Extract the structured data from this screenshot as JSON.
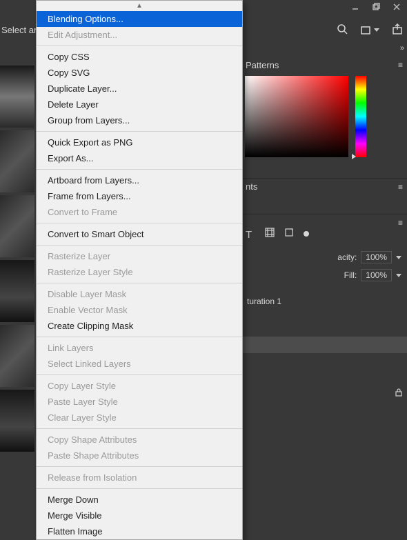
{
  "window": {
    "select_tool_text": "Select and"
  },
  "panels": {
    "tab_patterns": "Patterns",
    "tab_properties_fragment": "nts",
    "opacity_label": "acity:",
    "opacity_value": "100%",
    "fill_label": "Fill:",
    "fill_value": "100%",
    "adjustment_layer": "turation 1"
  },
  "menu": {
    "items": [
      {
        "label": "Blending Options...",
        "disabled": false,
        "highlight": true
      },
      {
        "label": "Edit Adjustment...",
        "disabled": true
      },
      {
        "sep": true
      },
      {
        "label": "Copy CSS"
      },
      {
        "label": "Copy SVG"
      },
      {
        "label": "Duplicate Layer..."
      },
      {
        "label": "Delete Layer"
      },
      {
        "label": "Group from Layers..."
      },
      {
        "sep": true
      },
      {
        "label": "Quick Export as PNG"
      },
      {
        "label": "Export As..."
      },
      {
        "sep": true
      },
      {
        "label": "Artboard from Layers..."
      },
      {
        "label": "Frame from Layers..."
      },
      {
        "label": "Convert to Frame",
        "disabled": true
      },
      {
        "sep": true
      },
      {
        "label": "Convert to Smart Object"
      },
      {
        "sep": true
      },
      {
        "label": "Rasterize Layer",
        "disabled": true
      },
      {
        "label": "Rasterize Layer Style",
        "disabled": true
      },
      {
        "sep": true
      },
      {
        "label": "Disable Layer Mask",
        "disabled": true
      },
      {
        "label": "Enable Vector Mask",
        "disabled": true
      },
      {
        "label": "Create Clipping Mask"
      },
      {
        "sep": true
      },
      {
        "label": "Link Layers",
        "disabled": true
      },
      {
        "label": "Select Linked Layers",
        "disabled": true
      },
      {
        "sep": true
      },
      {
        "label": "Copy Layer Style",
        "disabled": true
      },
      {
        "label": "Paste Layer Style",
        "disabled": true
      },
      {
        "label": "Clear Layer Style",
        "disabled": true
      },
      {
        "sep": true
      },
      {
        "label": "Copy Shape Attributes",
        "disabled": true
      },
      {
        "label": "Paste Shape Attributes",
        "disabled": true
      },
      {
        "sep": true
      },
      {
        "label": "Release from Isolation",
        "disabled": true
      },
      {
        "sep": true
      },
      {
        "label": "Merge Down"
      },
      {
        "label": "Merge Visible"
      },
      {
        "label": "Flatten Image"
      }
    ]
  }
}
